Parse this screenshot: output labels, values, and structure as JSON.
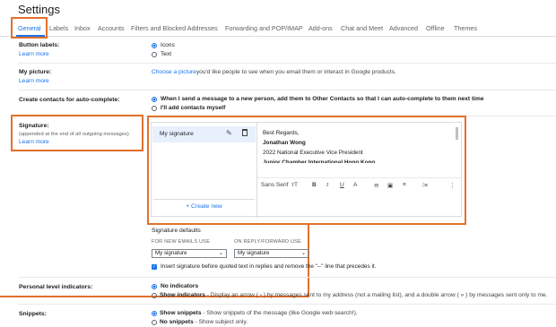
{
  "page": {
    "title": "Settings"
  },
  "tabs": [
    {
      "label": "General",
      "active": true
    },
    {
      "label": "Labels"
    },
    {
      "label": "Inbox"
    },
    {
      "label": "Accounts"
    },
    {
      "label": "Filters and Blocked Addresses"
    },
    {
      "label": "Forwarding and POP/IMAP"
    },
    {
      "label": "Add-ons"
    },
    {
      "label": "Chat and Meet"
    },
    {
      "label": "Advanced"
    },
    {
      "label": "Offline"
    },
    {
      "label": "Themes"
    }
  ],
  "button_labels": {
    "label": "Button labels:",
    "learn_more": "Learn more",
    "options": [
      "Icons",
      "Text"
    ]
  },
  "my_picture": {
    "label": "My picture:",
    "learn_more": "Learn more",
    "link": "Choose a picture",
    "text": " you'd like people to see when you email them or interact in Google products."
  },
  "contacts": {
    "label": "Create contacts for auto-complete:",
    "options": [
      "When I send a message to a new person, add them to Other Contacts so that I can auto-complete to them next time",
      "I'll add contacts myself"
    ]
  },
  "signature": {
    "label": "Signature:",
    "note": "(appended at the end of all outgoing messages)",
    "learn_more": "Learn more",
    "item_name": "My signature",
    "create_new": "+  Create new",
    "body": {
      "line1": "Best Regards,",
      "name": "Jonathan Wong",
      "role": "2022 National Executive Vice President",
      "org": "Junior Chamber International Hong Kong"
    },
    "toolbar": {
      "font": "Sans Serif",
      "size": "тT",
      "bold": "B",
      "italic": "I",
      "underline": "U",
      "color": "A",
      "link": "⊖",
      "image": "▣",
      "align": "≡",
      "list": "⁝≡",
      "more": "⋮"
    },
    "defaults_title": "Signature defaults",
    "new_emails_label": "FOR NEW EMAILS USE",
    "reply_label": "ON REPLY/FORWARD USE",
    "new_emails_value": "My signature",
    "reply_value": "My signature",
    "insert_note": "Insert signature before quoted text in replies and remove the \"--\" line that precedes it."
  },
  "personal_indicators": {
    "label": "Personal level indicators:",
    "opt1": "No indicators",
    "opt2_bold": "Show indicators",
    "opt2_desc": " - Display an arrow ( › ) by messages sent to my address (not a mailing list), and a double arrow ( » ) by messages sent only to me."
  },
  "snippets": {
    "label": "Snippets:",
    "opt1_bold": "Show snippets",
    "opt1_desc": " - Show snippets of the message (like Google web search!).",
    "opt2_bold": "No snippets",
    "opt2_desc": " - Show subject only."
  },
  "colors": {
    "accent": "#1a73e8",
    "highlight": "#e2702d"
  }
}
